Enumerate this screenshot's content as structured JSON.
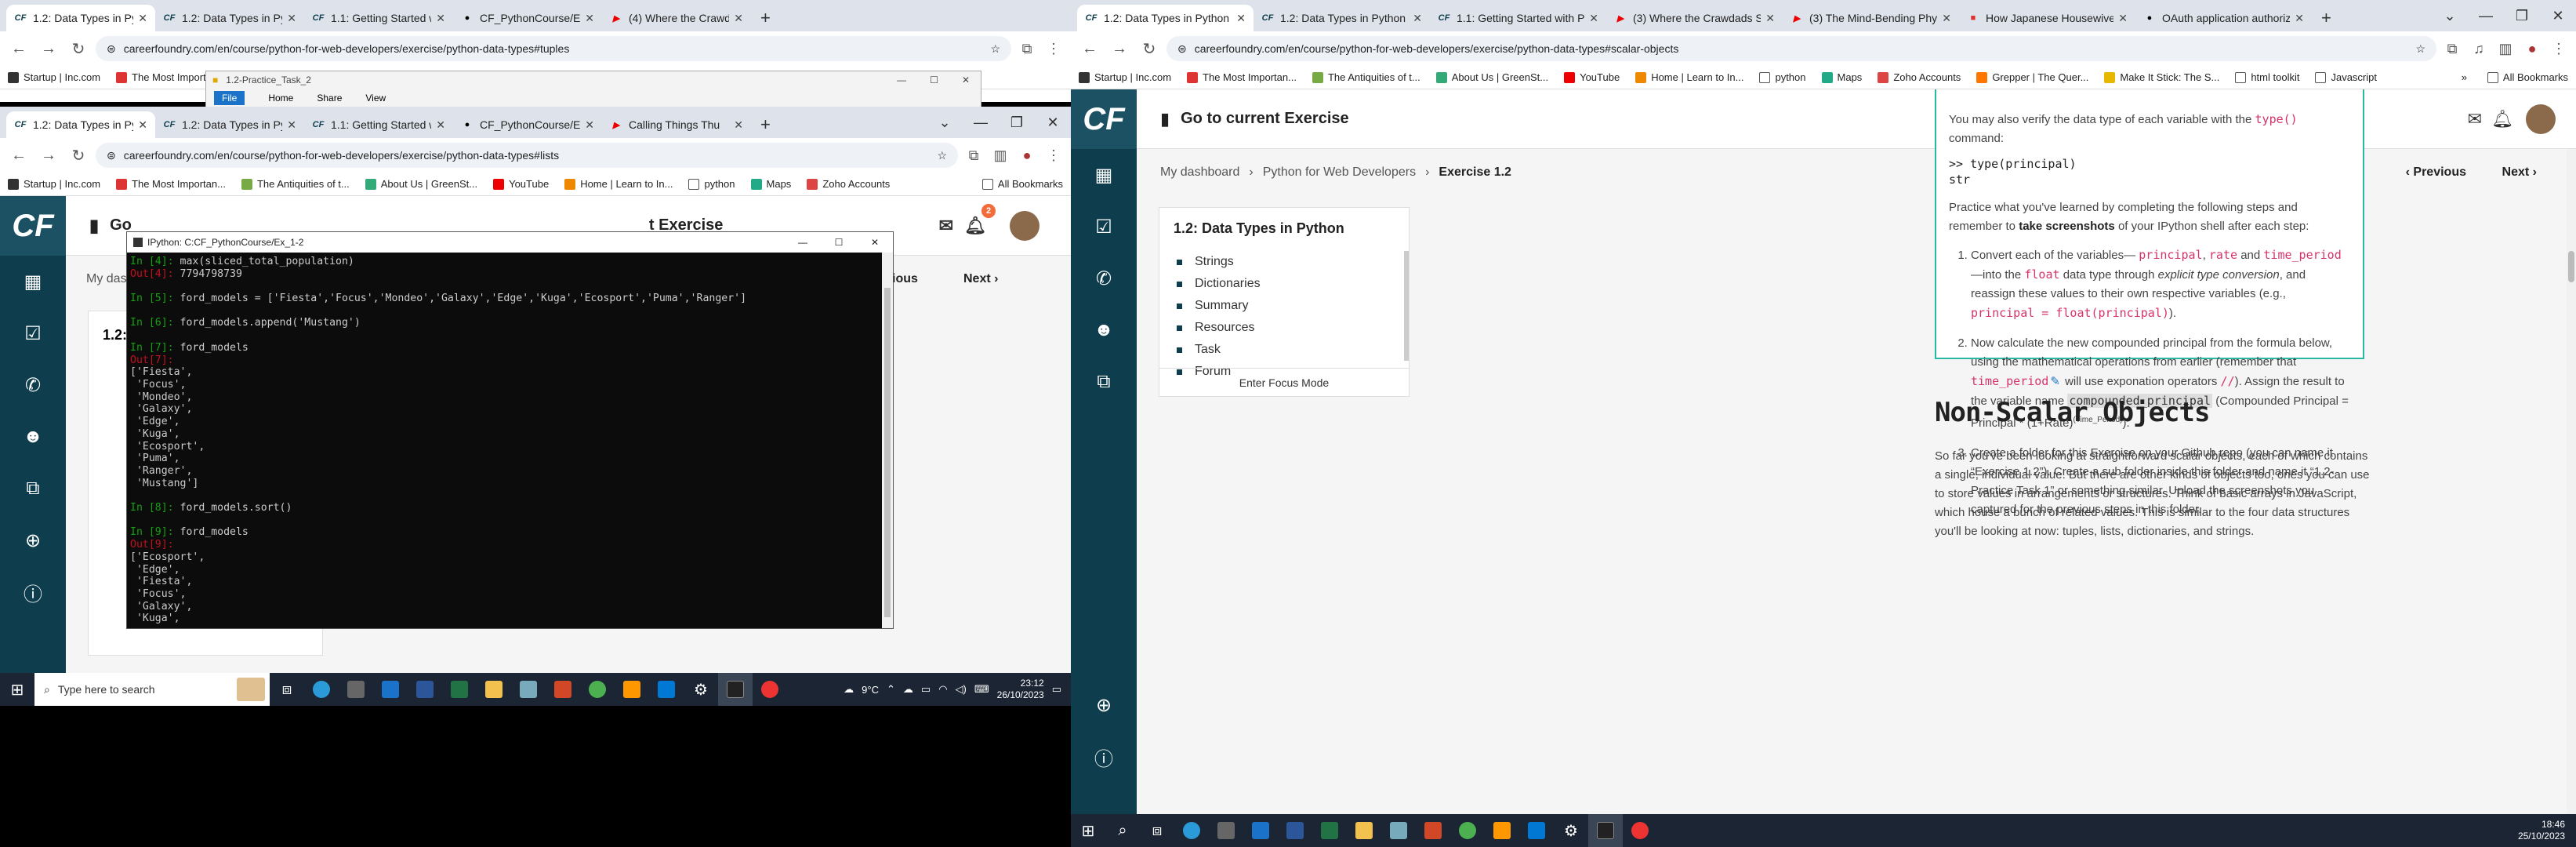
{
  "left": {
    "back_window": {
      "tabs": [
        {
          "label": "1.2: Data Types in Python",
          "active": true
        },
        {
          "label": "1.2: Data Types in Python"
        },
        {
          "label": "1.1: Getting Started with Py"
        },
        {
          "label": "CF_PythonCourse/Ex_1-2/1"
        },
        {
          "label": "(4) Where the Crawdad"
        }
      ],
      "url": "careerfoundry.com/en/course/python-for-web-developers/exercise/python-data-types#tuples",
      "bookmarks": [
        "Startup | Inc.com",
        "The Most Import"
      ],
      "all_bookmarks": "All Bookmarks"
    },
    "explorer_window": {
      "title": "1.2-Practice_Task_2",
      "ribbon": [
        "File",
        "Home",
        "Share",
        "View"
      ]
    },
    "front_window": {
      "tabs": [
        {
          "label": "1.2: Data Types in Python",
          "active": true
        },
        {
          "label": "1.2: Data Types in Python"
        },
        {
          "label": "1.1: Getting Started with Py"
        },
        {
          "label": "CF_PythonCourse/Ex_1-2/1"
        },
        {
          "label": "Calling Things Thu"
        }
      ],
      "url": "careerfoundry.com/en/course/python-for-web-developers/exercise/python-data-types#lists",
      "bookmarks": [
        "Startup | Inc.com",
        "The Most Importan...",
        "The Antiquities of t...",
        "About Us | GreenSt...",
        "YouTube",
        "Home | Learn to In...",
        "python",
        "Maps",
        "Zoho Accounts"
      ],
      "all_bookmarks": "All Bookmarks",
      "cf_header_partial": "Go",
      "cf_header_partial2": "t Exercise",
      "dashboard_partial": "My das",
      "prev": "revious",
      "next": "Next",
      "section_partial": "1.2:",
      "notif_count": "2"
    },
    "ipython": {
      "title": "IPython: C:CF_PythonCourse/Ex_1-2",
      "lines": [
        {
          "p": "In [4]:",
          "t": " max(sliced_total_population)"
        },
        {
          "p": "Out[4]:",
          "t": " 7794798739"
        },
        {
          "p": "",
          "t": ""
        },
        {
          "p": "In [5]:",
          "t": " ford_models = ['Fiesta','Focus','Mondeo','Galaxy','Edge','Kuga','Ecosport','Puma','Ranger']"
        },
        {
          "p": "",
          "t": ""
        },
        {
          "p": "In [6]:",
          "t": " ford_models.append('Mustang')"
        },
        {
          "p": "",
          "t": ""
        },
        {
          "p": "In [7]:",
          "t": " ford_models"
        },
        {
          "p": "Out[7]:",
          "t": ""
        },
        {
          "p": "",
          "t": "['Fiesta',"
        },
        {
          "p": "",
          "t": " 'Focus',"
        },
        {
          "p": "",
          "t": " 'Mondeo',"
        },
        {
          "p": "",
          "t": " 'Galaxy',"
        },
        {
          "p": "",
          "t": " 'Edge',"
        },
        {
          "p": "",
          "t": " 'Kuga',"
        },
        {
          "p": "",
          "t": " 'Ecosport',"
        },
        {
          "p": "",
          "t": " 'Puma',"
        },
        {
          "p": "",
          "t": " 'Ranger',"
        },
        {
          "p": "",
          "t": " 'Mustang']"
        },
        {
          "p": "",
          "t": ""
        },
        {
          "p": "In [8]:",
          "t": " ford_models.sort()"
        },
        {
          "p": "",
          "t": ""
        },
        {
          "p": "In [9]:",
          "t": " ford_models"
        },
        {
          "p": "Out[9]:",
          "t": ""
        },
        {
          "p": "",
          "t": "['Ecosport',"
        },
        {
          "p": "",
          "t": " 'Edge',"
        },
        {
          "p": "",
          "t": " 'Fiesta',"
        },
        {
          "p": "",
          "t": " 'Focus',"
        },
        {
          "p": "",
          "t": " 'Galaxy',"
        },
        {
          "p": "",
          "t": " 'Kuga',"
        }
      ]
    },
    "taskbar": {
      "search": "Type here to search",
      "weather": "9°C",
      "time": "23:12",
      "date": "26/10/2023"
    }
  },
  "right": {
    "tabs": [
      {
        "label": "1.2: Data Types in Python",
        "active": true
      },
      {
        "label": "1.2: Data Types in Python"
      },
      {
        "label": "1.1: Getting Started with Pytho"
      },
      {
        "label": "(3) Where the Crawdads S"
      },
      {
        "label": "(3) The Mind-Bending Physic"
      },
      {
        "label": "How Japanese Housewives O"
      },
      {
        "label": "OAuth application authorized"
      }
    ],
    "url": "careerfoundry.com/en/course/python-for-web-developers/exercise/python-data-types#scalar-objects",
    "bookmarks": [
      "Startup | Inc.com",
      "The Most Importan...",
      "The Antiquities of t...",
      "About Us | GreenSt...",
      "YouTube",
      "Home | Learn to In...",
      "python",
      "Maps",
      "Zoho Accounts",
      "Grepper | The Quer...",
      "Make It Stick: The S...",
      "html toolkit",
      "Javascript"
    ],
    "all_bookmarks": "All Bookmarks",
    "header_link": "Go to current Exercise",
    "breadcrumb": [
      "My dashboard",
      "Python for Web Developers",
      "Exercise 1.2"
    ],
    "prev": "Previous",
    "next": "Next",
    "toc": {
      "title": "1.2: Data Types in Python",
      "items": [
        "Strings",
        "Dictionaries",
        "Summary",
        "Resources",
        "Task",
        "Forum"
      ],
      "focus": "Enter Focus Mode"
    },
    "content": {
      "intro_a": "You may also verify the data type of each variable with the ",
      "intro_code": "type()",
      "intro_b": " command:",
      "code_line": ">> type(principal)",
      "code_out": "str",
      "practice_a": "Practice what you've learned by completing the following steps and remember to ",
      "practice_bold": "take screenshots",
      "practice_b": " of your IPython shell after each step:",
      "s1_a": "Convert each of the variables— ",
      "s1_c1": "principal",
      "s1_c2": "rate",
      "s1_and": " and ",
      "s1_c3": "time_period",
      "s1_b": " —into the ",
      "s1_c4": "float",
      "s1_c": " data type through ",
      "s1_em": "explicit type conversion",
      "s1_d": ", and reassign these values to their own respective variables (e.g., ",
      "s1_c5": "principal = float(principal)",
      "s1_e": ").",
      "s2_a": "Now calculate the new compounded principal from the formula below, using the mathematical operations from earlier (remember that ",
      "s2_c1": "time_period",
      "s2_b": " will use exponation operators ",
      "s2_c2": "//",
      "s2_c": "). Assign the result to the variable name ",
      "s2_c3": "compounded_principal",
      "s2_d": " (Compounded Principal = Principal * (1+Rate)",
      "s2_sup": "(Time_Period)",
      "s2_e": ").",
      "s3": "Create a folder for this Exercise on your Github repo (you can name it “Exercise 1.2”). Create a sub folder inside this folder and name it “1.2-Practice Task 1” or something similar. Upload the screenshots you captured for the previous steps in this folder.",
      "heading": "Non-Scalar Objects",
      "para": "So far you've been looking at straightforward scalar objects, each of which contains a single, individual value. But there are other kinds of objects too, ones you can use to store values in arrangements or structures. Think of basic arrays in JavaScript, which house a bunch of related values. This is similar to the four data structures you'll be looking at now: tuples, lists, dictionaries, and strings."
    },
    "taskbar": {
      "time": "18:46",
      "date": "25/10/2023"
    }
  },
  "colors": {
    "cf_sidebar": "#0e3d4d",
    "cf_accent": "#1b5162",
    "code_pink": "#d6336c",
    "box_border": "#2bb8a3",
    "taskbar_dark": "#1c2533"
  }
}
